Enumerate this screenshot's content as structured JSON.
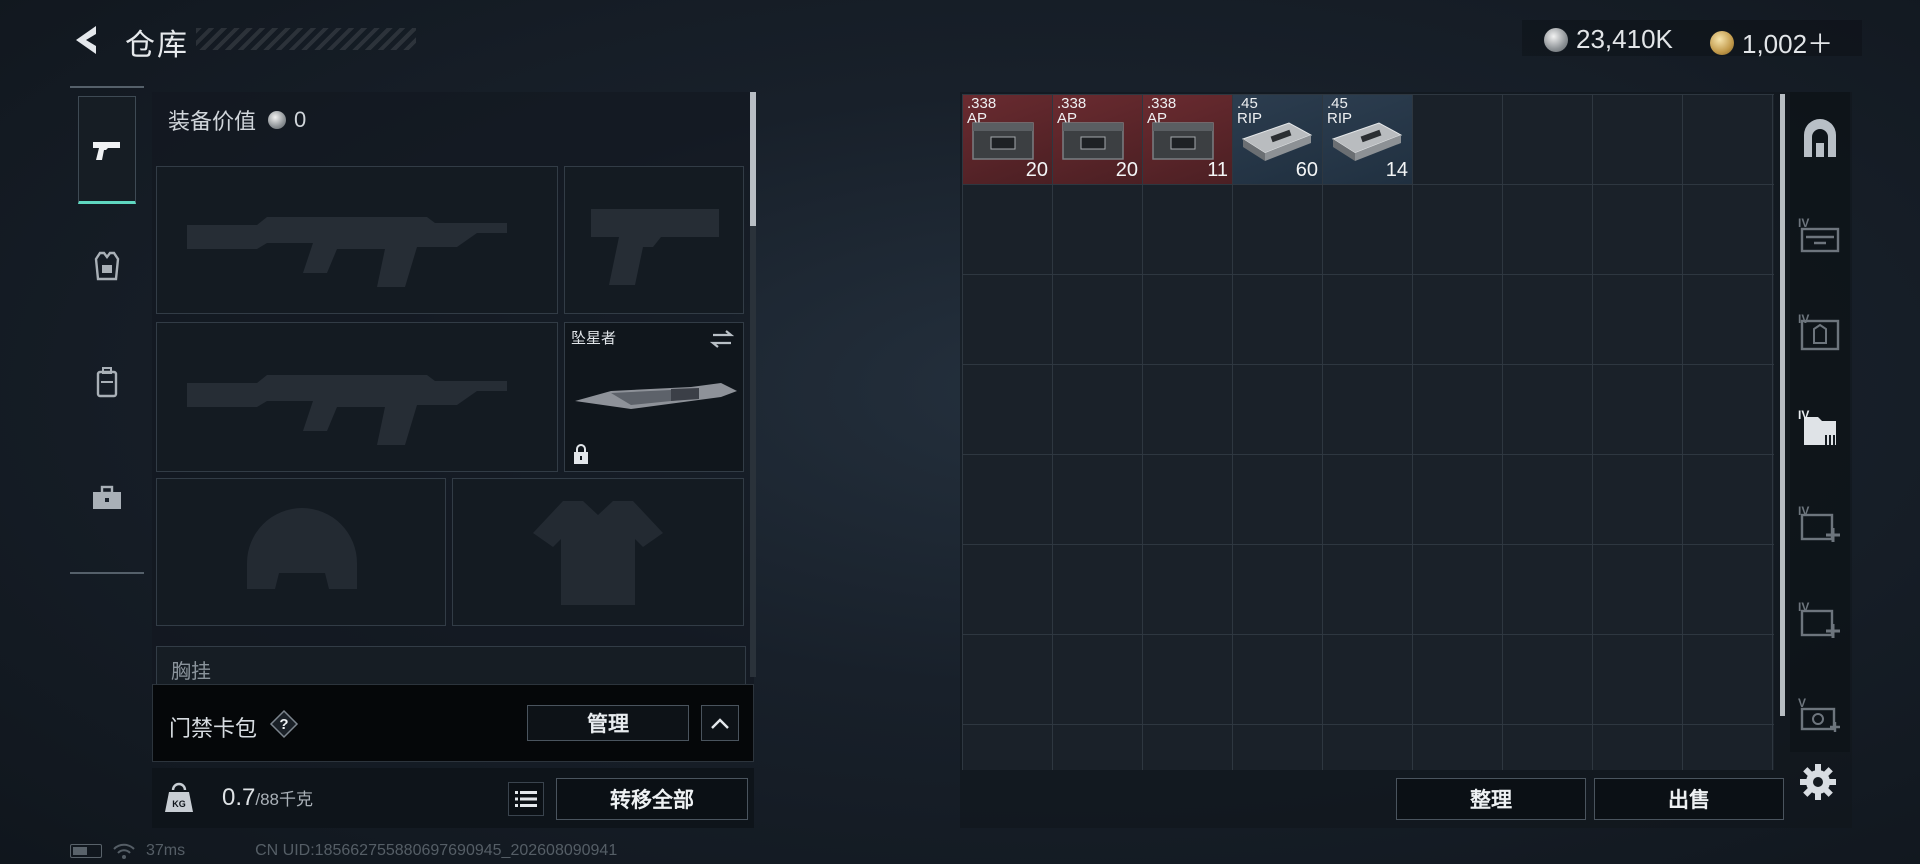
{
  "header": {
    "title": "仓库",
    "currencies": [
      {
        "icon": "silver-coin-icon",
        "value": "23,410K"
      },
      {
        "icon": "gold-coin-icon",
        "value": "1,002＋"
      }
    ]
  },
  "left_nav": {
    "items": [
      {
        "name": "weapons",
        "icon": "pistol-icon",
        "active": true
      },
      {
        "name": "armor",
        "icon": "armor-vest-icon",
        "active": false
      },
      {
        "name": "backpack",
        "icon": "backpack-icon",
        "active": false
      },
      {
        "name": "toolbox",
        "icon": "toolbox-icon",
        "active": false
      }
    ]
  },
  "equipment": {
    "value_label": "装备价值",
    "value": "0",
    "melee_slot_label": "坠星者",
    "chest_rig_label": "胸挂"
  },
  "keycard": {
    "label": "门禁卡包",
    "help": "?",
    "manage_label": "管理"
  },
  "weight": {
    "current": "0.7",
    "max": "/88千克",
    "transfer_label": "转移全部"
  },
  "status": {
    "ping": "37ms",
    "uid": "CN UID:185662755880697690945_202608090941"
  },
  "storage": {
    "items": [
      {
        "caliber": ".338",
        "type": "AP",
        "qty": "20",
        "kind": "ap"
      },
      {
        "caliber": ".338",
        "type": "AP",
        "qty": "20",
        "kind": "ap"
      },
      {
        "caliber": ".338",
        "type": "AP",
        "qty": "11",
        "kind": "ap"
      },
      {
        "caliber": ".45",
        "type": "RIP",
        "qty": "60",
        "kind": "rip"
      },
      {
        "caliber": ".45",
        "type": "RIP",
        "qty": "14",
        "kind": "rip"
      }
    ],
    "sort_label": "整理",
    "sell_label": "出售"
  },
  "right_tabs": {
    "items": [
      {
        "icon": "safe-box-icon",
        "tier": ""
      },
      {
        "icon": "weapon-case-icon",
        "tier": "IV"
      },
      {
        "icon": "armor-case-icon",
        "tier": "IV"
      },
      {
        "icon": "document-case-icon",
        "tier": "IV"
      },
      {
        "icon": "medical-case-icon",
        "tier": "IV"
      },
      {
        "icon": "medical-case-icon",
        "tier": "IV"
      },
      {
        "icon": "ammo-case-icon",
        "tier": "V"
      }
    ]
  }
}
